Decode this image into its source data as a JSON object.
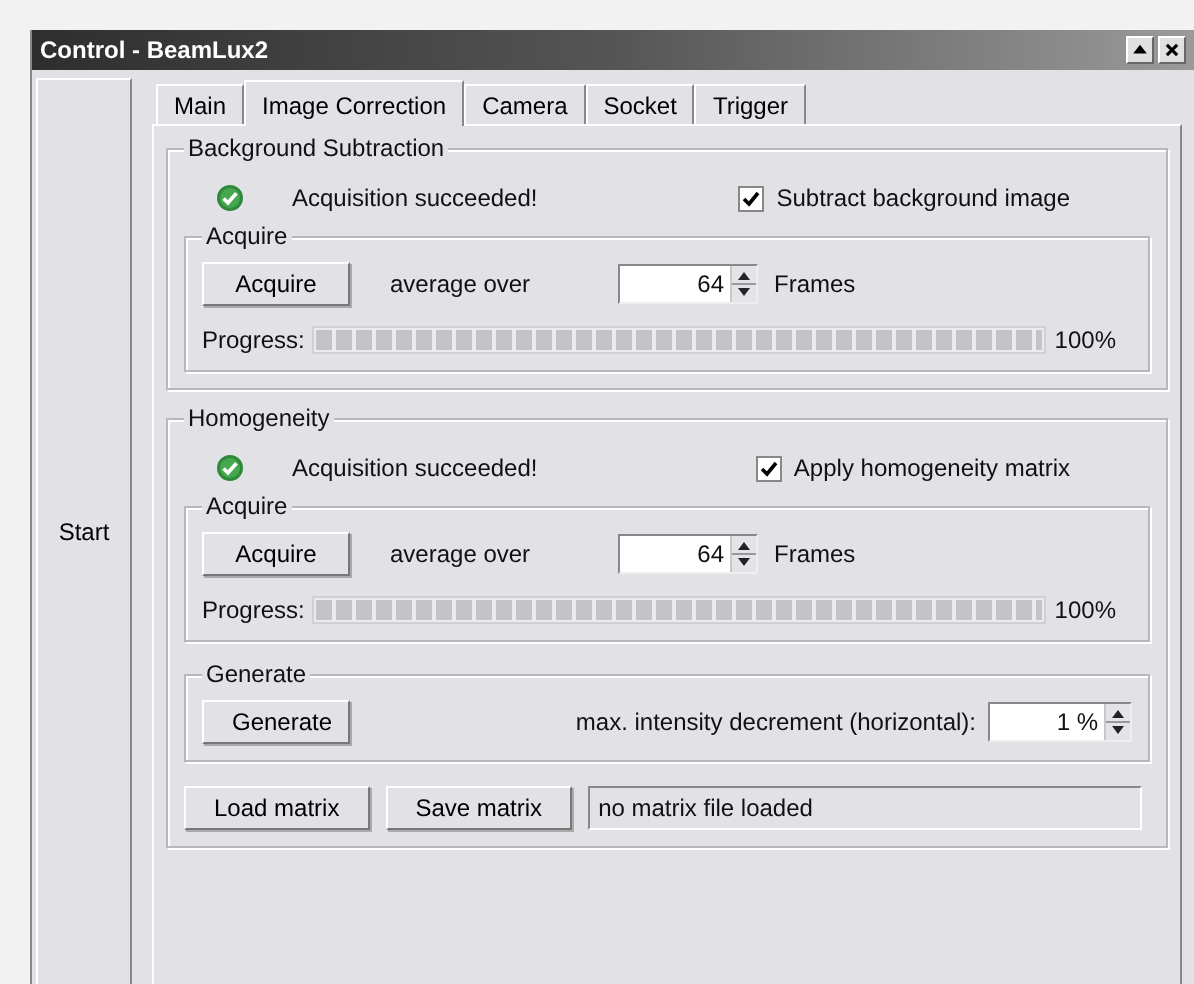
{
  "window": {
    "title": "Control - BeamLux2"
  },
  "start_button": "Start",
  "tabs": [
    {
      "label": "Main",
      "selected": false
    },
    {
      "label": "Image Correction",
      "selected": true
    },
    {
      "label": "Camera",
      "selected": false
    },
    {
      "label": "Socket",
      "selected": false
    },
    {
      "label": "Trigger",
      "selected": false
    }
  ],
  "background_subtraction": {
    "title": "Background Subtraction",
    "status": "Acquisition succeeded!",
    "checkbox": {
      "label": "Subtract background image",
      "checked": true
    },
    "acquire": {
      "title": "Acquire",
      "button": "Acquire",
      "average_label": "average over",
      "frames": "64",
      "frames_unit": "Frames",
      "progress_label": "Progress:",
      "level": 1,
      "reading": "100%"
    }
  },
  "homogeneity": {
    "title": "Homogeneity",
    "status": "Acquisition succeeded!",
    "checkbox": {
      "label": "Apply homogeneity matrix",
      "checked": true
    },
    "acquire": {
      "title": "Acquire",
      "button": "Acquire",
      "average_label": "average over",
      "frames": "64",
      "frames_unit": "Frames",
      "progress_label": "Progress:",
      "level": 1,
      "reading": "100%"
    },
    "generate": {
      "title": "Generate",
      "button": "Generate",
      "label": "max. intensity decrement (horizontal):",
      "value": "1 %"
    },
    "load_button": "Load matrix",
    "save_button": "Save matrix",
    "matrix_file": "no matrix file loaded"
  }
}
